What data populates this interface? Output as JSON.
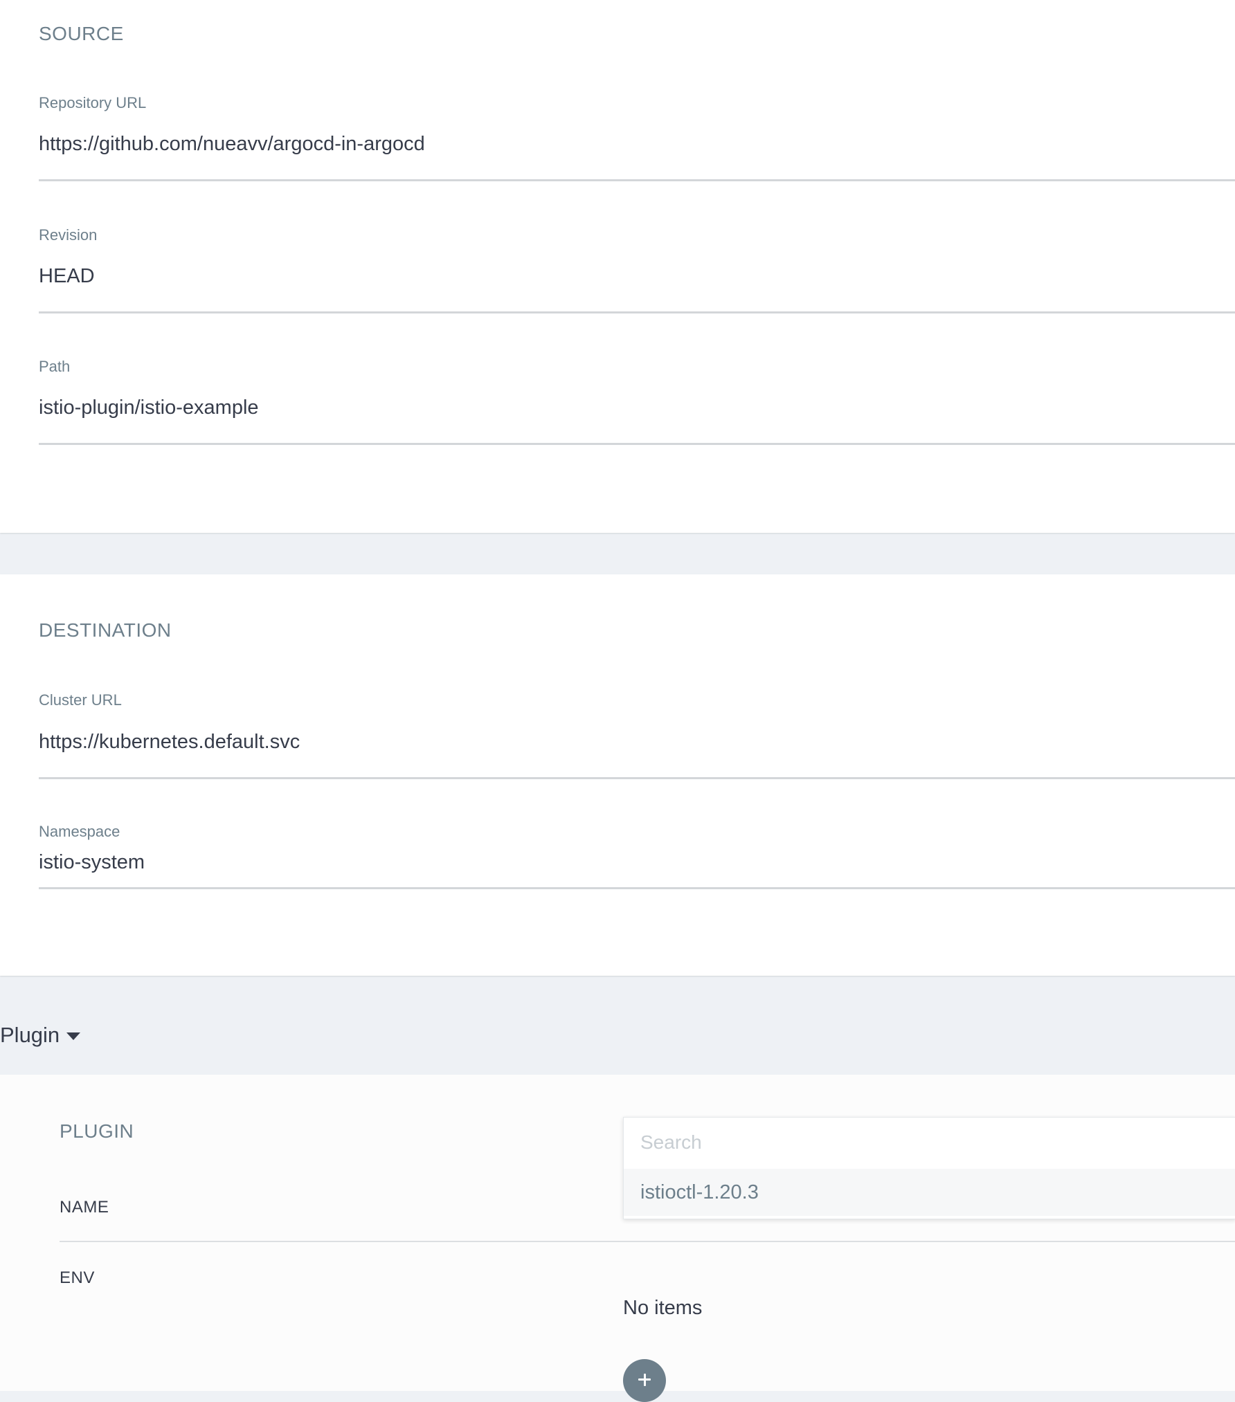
{
  "source": {
    "title": "SOURCE",
    "repo_url": {
      "label": "Repository URL",
      "value": "https://github.com/nueavv/argocd-in-argocd"
    },
    "revision": {
      "label": "Revision",
      "value": "HEAD"
    },
    "path": {
      "label": "Path",
      "value": "istio-plugin/istio-example"
    }
  },
  "destination": {
    "title": "DESTINATION",
    "cluster_url": {
      "label": "Cluster URL",
      "value": "https://kubernetes.default.svc"
    },
    "namespace": {
      "label": "Namespace",
      "value": "istio-system"
    }
  },
  "plugin_toggle": {
    "label": "Plugin",
    "icon": "caret-down-icon"
  },
  "plugin": {
    "title": "PLUGIN",
    "name_label": "NAME",
    "env_label": "ENV",
    "search": {
      "placeholder": "Search"
    },
    "options": [
      "istioctl-1.20.3"
    ],
    "env_empty_text": "No items",
    "add_icon": "plus-icon"
  },
  "colors": {
    "page_background": "#eef1f5",
    "panel_background": "#ffffff",
    "label_text": "#6d7f8b",
    "value_text": "#363c4a",
    "underline": "#d3d6d9",
    "add_button": "#6d7f8b"
  }
}
